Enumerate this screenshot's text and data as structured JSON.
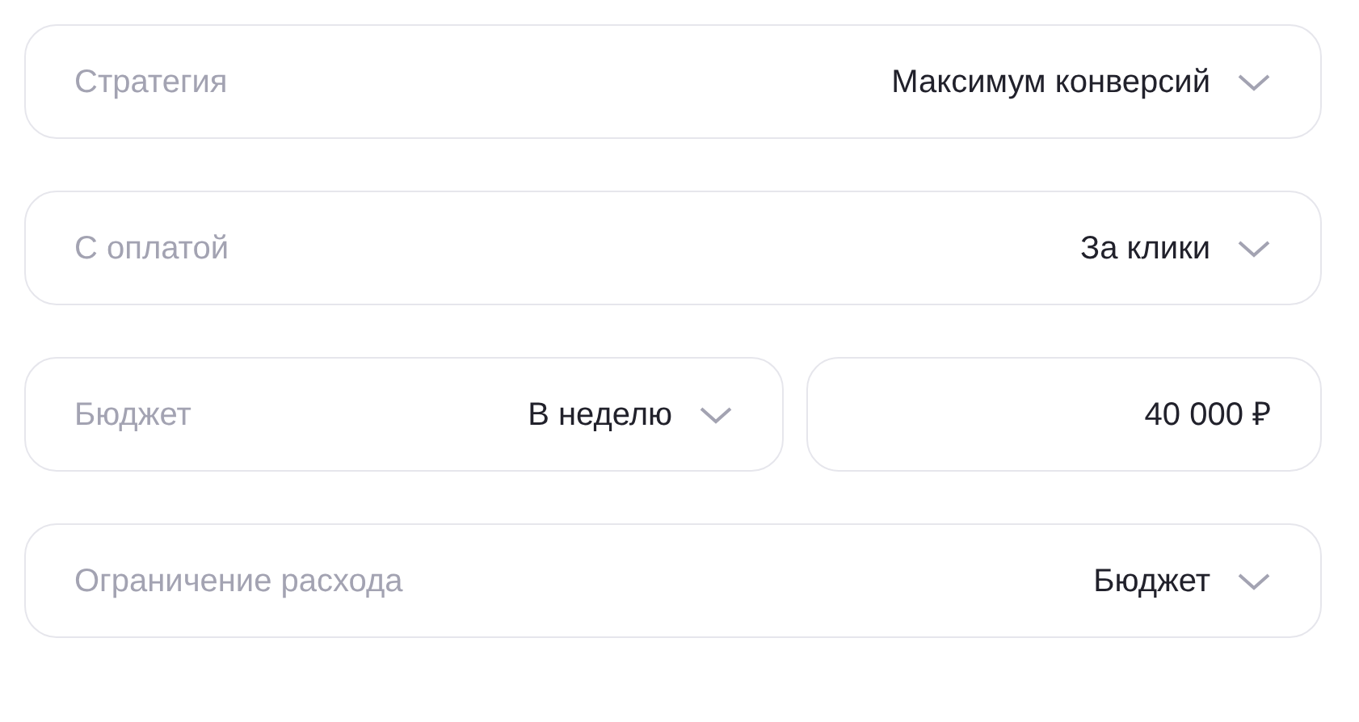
{
  "rows": [
    {
      "kind": "select",
      "label": "Стратегия",
      "value": "Максимум конверсий"
    },
    {
      "kind": "select",
      "label": "С оплатой",
      "value": "За клики"
    },
    {
      "kind": "split",
      "label": "Бюджет",
      "value": "В неделю",
      "amount": "40 000 ₽"
    },
    {
      "kind": "select",
      "label": "Ограничение расхода",
      "value": "Бюджет"
    }
  ]
}
